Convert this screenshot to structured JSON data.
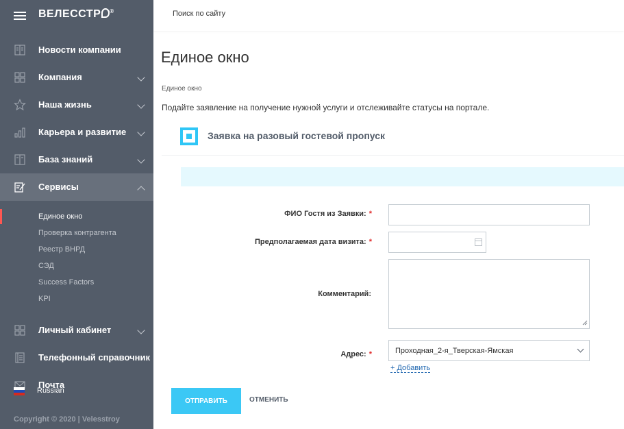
{
  "brand": {
    "logo_text": "ВЕЛЕССТР",
    "logo_suffix": "Й",
    "registered": "®"
  },
  "sidebar": {
    "items": [
      {
        "label": "Новости компании",
        "icon": "newspaper-icon",
        "has_chevron": false
      },
      {
        "label": "Компания",
        "icon": "grid-icon",
        "has_chevron": true
      },
      {
        "label": "Наша жизнь",
        "icon": "star-icon",
        "has_chevron": true
      },
      {
        "label": "Карьера и развитие",
        "icon": "chart-icon",
        "has_chevron": true
      },
      {
        "label": "База знаний",
        "icon": "book-icon",
        "has_chevron": true
      },
      {
        "label": "Сервисы",
        "icon": "edit-icon",
        "has_chevron": true,
        "expanded": true
      },
      {
        "label": "Личный кабинет",
        "icon": "grid-icon",
        "has_chevron": true
      },
      {
        "label": "Телефонный справочник",
        "icon": "phonebook-icon",
        "has_chevron": false
      },
      {
        "label": "Почта",
        "icon": "mail-icon",
        "has_chevron": false
      }
    ],
    "sub_items": [
      "Единое окно",
      "Проверка контрагента",
      "Реестр ВНРД",
      "СЭД",
      "Success Factors",
      "KPI"
    ],
    "current_sub": "Единое окно",
    "language": "Russian",
    "copyright": "Copyright © 2020 | Velesstroy"
  },
  "topbar": {
    "search_placeholder": "Поиск по сайту"
  },
  "page": {
    "title": "Единое окно",
    "breadcrumb": "Единое окно",
    "intro": "Подайте заявление на получение нужной услуги и отслеживайте статусы на портале."
  },
  "form": {
    "title": "Заявка на разовый гостевой пропуск",
    "fields": {
      "guest_name": {
        "label": "ФИО Гостя из Заявки:",
        "required": "*",
        "value": ""
      },
      "visit_date": {
        "label": "Предполагаемая дата визита:",
        "required": "*",
        "value": ""
      },
      "comment": {
        "label": "Комментарий:",
        "value": ""
      },
      "address": {
        "label": "Адрес:",
        "required": "*",
        "value": "Проходная_2-я_Тверская-Ямская"
      }
    },
    "add_link": "+ Добавить",
    "submit": "ОТПРАВИТЬ",
    "cancel": "ОТМЕНИТЬ"
  },
  "colors": {
    "sidebar_bg": "#535c69",
    "sidebar_active": "#68707c",
    "accent": "#2fc6f6",
    "submit_bg": "#3bc8f5",
    "info_band": "#e5f9fe",
    "required": "#e02a2a",
    "marker": "#ff5752"
  }
}
